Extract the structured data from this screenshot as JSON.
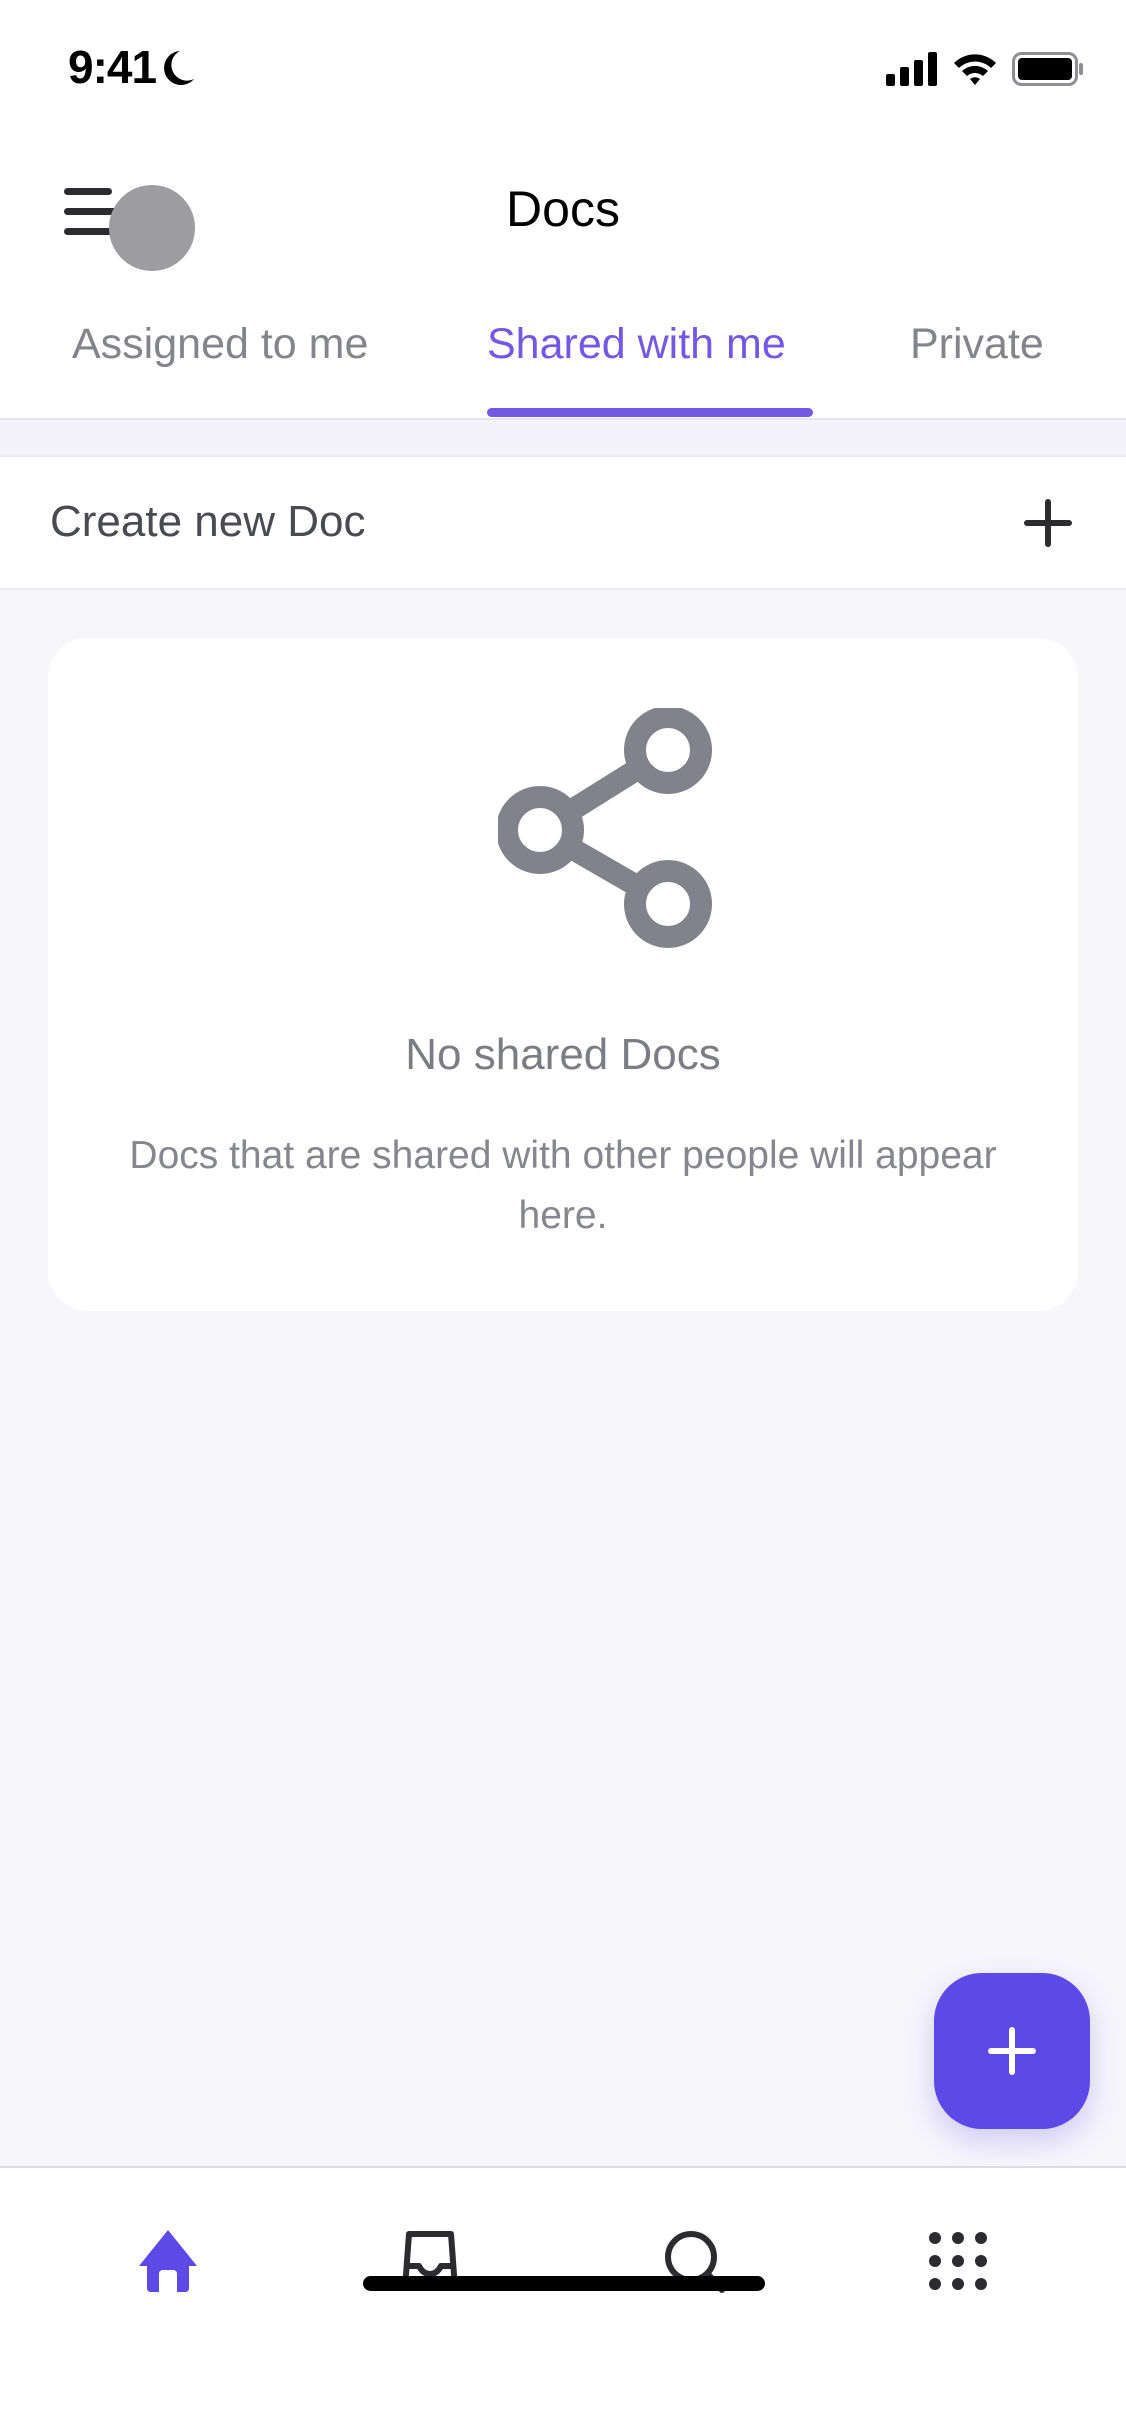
{
  "status_bar": {
    "time": "9:41",
    "icons": [
      "moon-icon",
      "cellular-signal-icon",
      "wifi-icon",
      "battery-icon"
    ]
  },
  "header": {
    "title": "Docs",
    "menu_icon": "hamburger-menu-icon",
    "avatar_icon": "avatar"
  },
  "tabs": [
    {
      "label": "Assigned to me",
      "active": false
    },
    {
      "label": "Shared with me",
      "active": true
    },
    {
      "label": "Private",
      "active": false
    }
  ],
  "create_row": {
    "label": "Create new Doc",
    "icon": "plus-icon"
  },
  "empty_state": {
    "icon": "share-icon",
    "title": "No shared Docs",
    "description": "Docs that are shared with other people will appear here."
  },
  "fab": {
    "icon": "plus-icon"
  },
  "tabbar": [
    {
      "name": "home",
      "icon": "home-icon",
      "active": true
    },
    {
      "name": "inbox",
      "icon": "inbox-icon",
      "active": false
    },
    {
      "name": "search",
      "icon": "search-icon",
      "active": false
    },
    {
      "name": "more",
      "icon": "grid-dots-icon",
      "active": false
    }
  ],
  "colors": {
    "accent": "#5d48e8",
    "active_tab": "#7357e6",
    "background": "#f7f6fb",
    "muted_text": "#84848c",
    "icon_gray": "#81828b"
  }
}
